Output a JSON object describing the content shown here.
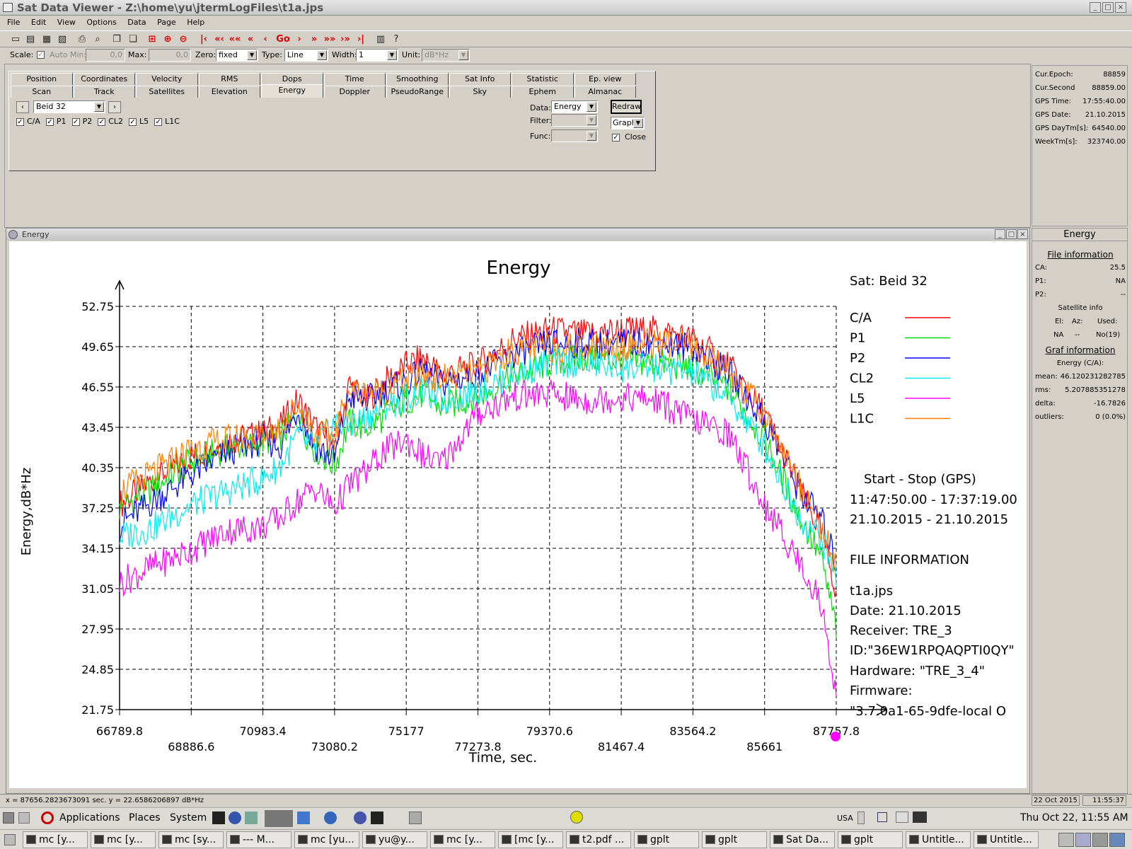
{
  "window": {
    "title": "Sat Data Viewer - Z:\\home\\yu\\jtermLogFiles\\t1a.jps"
  },
  "menu": [
    "File",
    "Edit",
    "View",
    "Options",
    "Data",
    "Page",
    "Help"
  ],
  "toolbar": {
    "go_label": "Go"
  },
  "scale": {
    "label": "Scale:",
    "auto_label": "Auto",
    "min_label": "Min:",
    "min_value": "0,0",
    "max_label": "Max:",
    "max_value": "0,0",
    "zero_label": "Zero:",
    "zero_value": "fixed",
    "type_label": "Type:",
    "type_value": "Line",
    "width_label": "Width:",
    "width_value": "1",
    "unit_label": "Unit:",
    "unit_value": "dB*Hz"
  },
  "tabs_row1": [
    "Position",
    "Coordinates",
    "Velocity",
    "RMS",
    "Dops",
    "Time",
    "Smoothing",
    "Sat Info",
    "Statistic",
    "Ep. view"
  ],
  "tabs_row2": [
    "Scan",
    "Track",
    "Satellites",
    "Elevation",
    "Energy",
    "Doppler",
    "PseudoRange",
    "Sky",
    "Ephem",
    "Almanac"
  ],
  "selected_tab": "Energy",
  "controls": {
    "satellite": "Beid  32",
    "checks": [
      "C/A",
      "P1",
      "P2",
      "CL2",
      "L5",
      "L1C"
    ],
    "data_label": "Data:",
    "data_value": "Energy",
    "filter_label": "Filter:",
    "func_label": "Func:",
    "redraw": "Redraw",
    "graph": "Graph",
    "close_label": "Close"
  },
  "epoch_info": [
    {
      "k": "Cur.Epoch:",
      "v": "88859"
    },
    {
      "k": "Cur.Second",
      "v": "88859.00"
    },
    {
      "k": "GPS Time:",
      "v": "17:55:40.00"
    },
    {
      "k": "GPS Date:",
      "v": "21.10.2015"
    },
    {
      "k": "GPS DayTm[s]:",
      "v": "64540.00"
    },
    {
      "k": "WeekTm[s]:",
      "v": "323740.00"
    }
  ],
  "chart_window": {
    "title": "Energy"
  },
  "side": {
    "title": "Energy",
    "file_info": "File information",
    "ca_k": "CA:",
    "ca_v": "25.5",
    "p1_k": "P1:",
    "p1_v": "NA",
    "p2_k": "P2:",
    "p2_v": "--",
    "sat_info": "Satellite info",
    "el": "El:",
    "az": "Az:",
    "used": "Used:",
    "el_v": "NA",
    "az_v": "--",
    "used_v": "No(19)",
    "graf_info": "Graf information",
    "graf_sub": "Energy  (C/A):",
    "mean_k": "mean:",
    "mean_v": "46.120231282785",
    "rms_k": "rms:",
    "rms_v": "5.207885351278",
    "delta_k": "delta:",
    "delta_v": "-16.7826",
    "outliers_k": "outliers:",
    "outliers_v": "0 (0.0%)"
  },
  "chart_data": {
    "type": "line",
    "title": "Energy",
    "xlabel": "Time, sec.",
    "ylabel": "Energy,dB*Hz",
    "xlim": [
      66789.8,
      87757.8
    ],
    "ylim": [
      21.75,
      52.75
    ],
    "xticks": [
      "66789.8",
      "68886.6",
      "70983.4",
      "73080.2",
      "75177",
      "77273.8",
      "79370.6",
      "81467.4",
      "83564.2",
      "85661",
      "87757.8"
    ],
    "yticks": [
      "52.75",
      "49.65",
      "46.55",
      "43.45",
      "40.35",
      "37.25",
      "34.15",
      "31.05",
      "27.95",
      "24.85",
      "21.75"
    ],
    "grid": true,
    "sat_label": "Sat: Beid  32",
    "x": [
      66789.8,
      67800,
      68886.6,
      69900,
      70983.4,
      71500,
      72000,
      72500,
      73080.2,
      73500,
      74000,
      74500,
      75177,
      75700,
      76200,
      77273.8,
      78300,
      79370.6,
      80400,
      81467.4,
      82500,
      83564.2,
      84600,
      85661,
      86700,
      87300,
      87757.8
    ],
    "series": [
      {
        "name": "C/A",
        "color": "#ff0000",
        "values": [
          37.5,
          39.5,
          41.2,
          42.3,
          43.0,
          43.6,
          45.5,
          43.5,
          41.8,
          46.8,
          45.5,
          46.8,
          48.2,
          48.8,
          47.5,
          48.2,
          50.2,
          50.9,
          50.6,
          50.9,
          50.9,
          50.2,
          48.2,
          44.5,
          38.5,
          35.5,
          31.0
        ]
      },
      {
        "name": "P1",
        "color": "#00dd00",
        "values": [
          37.2,
          38.8,
          40.8,
          41.8,
          42.3,
          42.8,
          44.2,
          41.8,
          40.5,
          43.8,
          43.4,
          44.2,
          45.5,
          46.0,
          45.0,
          45.8,
          47.3,
          48.4,
          48.8,
          48.5,
          48.4,
          48.0,
          46.5,
          42.5,
          36.5,
          33.5,
          28.0
        ]
      },
      {
        "name": "P2",
        "color": "#0000ff",
        "values": [
          36.0,
          37.8,
          39.8,
          41.5,
          42.5,
          42.0,
          44.8,
          42.0,
          41.0,
          45.8,
          45.5,
          46.2,
          46.9,
          47.8,
          46.8,
          47.6,
          49.0,
          49.9,
          49.9,
          49.9,
          50.0,
          49.6,
          47.6,
          44.0,
          38.5,
          36.5,
          33.0
        ]
      },
      {
        "name": "CL2",
        "color": "#00eeee",
        "values": [
          35.0,
          35.8,
          37.5,
          38.5,
          39.5,
          40.5,
          42.8,
          41.8,
          43.8,
          43.5,
          44.2,
          45.0,
          45.8,
          46.3,
          45.5,
          46.3,
          47.5,
          48.4,
          48.4,
          48.0,
          48.0,
          47.6,
          45.8,
          42.0,
          36.5,
          35.0,
          32.0
        ]
      },
      {
        "name": "L5",
        "color": "#ff00ff",
        "values": [
          31.5,
          32.8,
          34.0,
          35.5,
          35.8,
          36.5,
          37.8,
          38.8,
          37.3,
          39.0,
          40.0,
          41.5,
          42.5,
          41.2,
          40.6,
          44.5,
          45.8,
          46.0,
          45.5,
          45.8,
          45.5,
          44.0,
          43.0,
          37.5,
          33.0,
          30.0,
          23.0
        ]
      },
      {
        "name": "L1C",
        "color": "#ff8000",
        "values": [
          38.5,
          40.0,
          41.8,
          42.5,
          42.8,
          43.5,
          45.2,
          43.0,
          42.8,
          46.3,
          46.0,
          46.3,
          47.0,
          47.5,
          47.2,
          47.6,
          49.4,
          49.6,
          49.7,
          49.7,
          50.0,
          49.6,
          47.8,
          44.5,
          39.0,
          36.0,
          32.5
        ]
      }
    ]
  },
  "legend_info": {
    "start_stop": "Start  -  Stop  (GPS)",
    "times": "11:47:50.00 - 17:37:19.00",
    "dates": "21.10.2015 - 21.10.2015",
    "file_hdr": "FILE INFORMATION",
    "file": "t1a.jps",
    "date": "Date: 21.10.2015",
    "receiver": "Receiver: TRE_3",
    "id": "ID:\"36EW1RPQAQPTI0QY\"",
    "hardware": "Hardware: \"TRE_3_4\"",
    "firmware": "Firmware:",
    "firmware_v": "\"3.7.0a1-65-9dfe-local O"
  },
  "status": {
    "coords": "x = 87656.2823673091  sec.  y = 22.6586206897 dB*Hz",
    "date": "22 Oct 2015",
    "time": "11:55:37"
  },
  "panel": {
    "applications": "Applications",
    "places": "Places",
    "system": "System",
    "kbd": "USA",
    "clock": "Thu Oct 22, 11:55 AM"
  },
  "tasks": [
    "mc [y...",
    "mc [y...",
    "mc [sy...",
    "--- M...",
    "mc [yu...",
    "yu@y...",
    "mc [y...",
    "[mc [y...",
    "t2.pdf ...",
    "gplt",
    "gplt",
    "Sat Da...",
    "gplt",
    "Untitle...",
    "Untitle..."
  ]
}
